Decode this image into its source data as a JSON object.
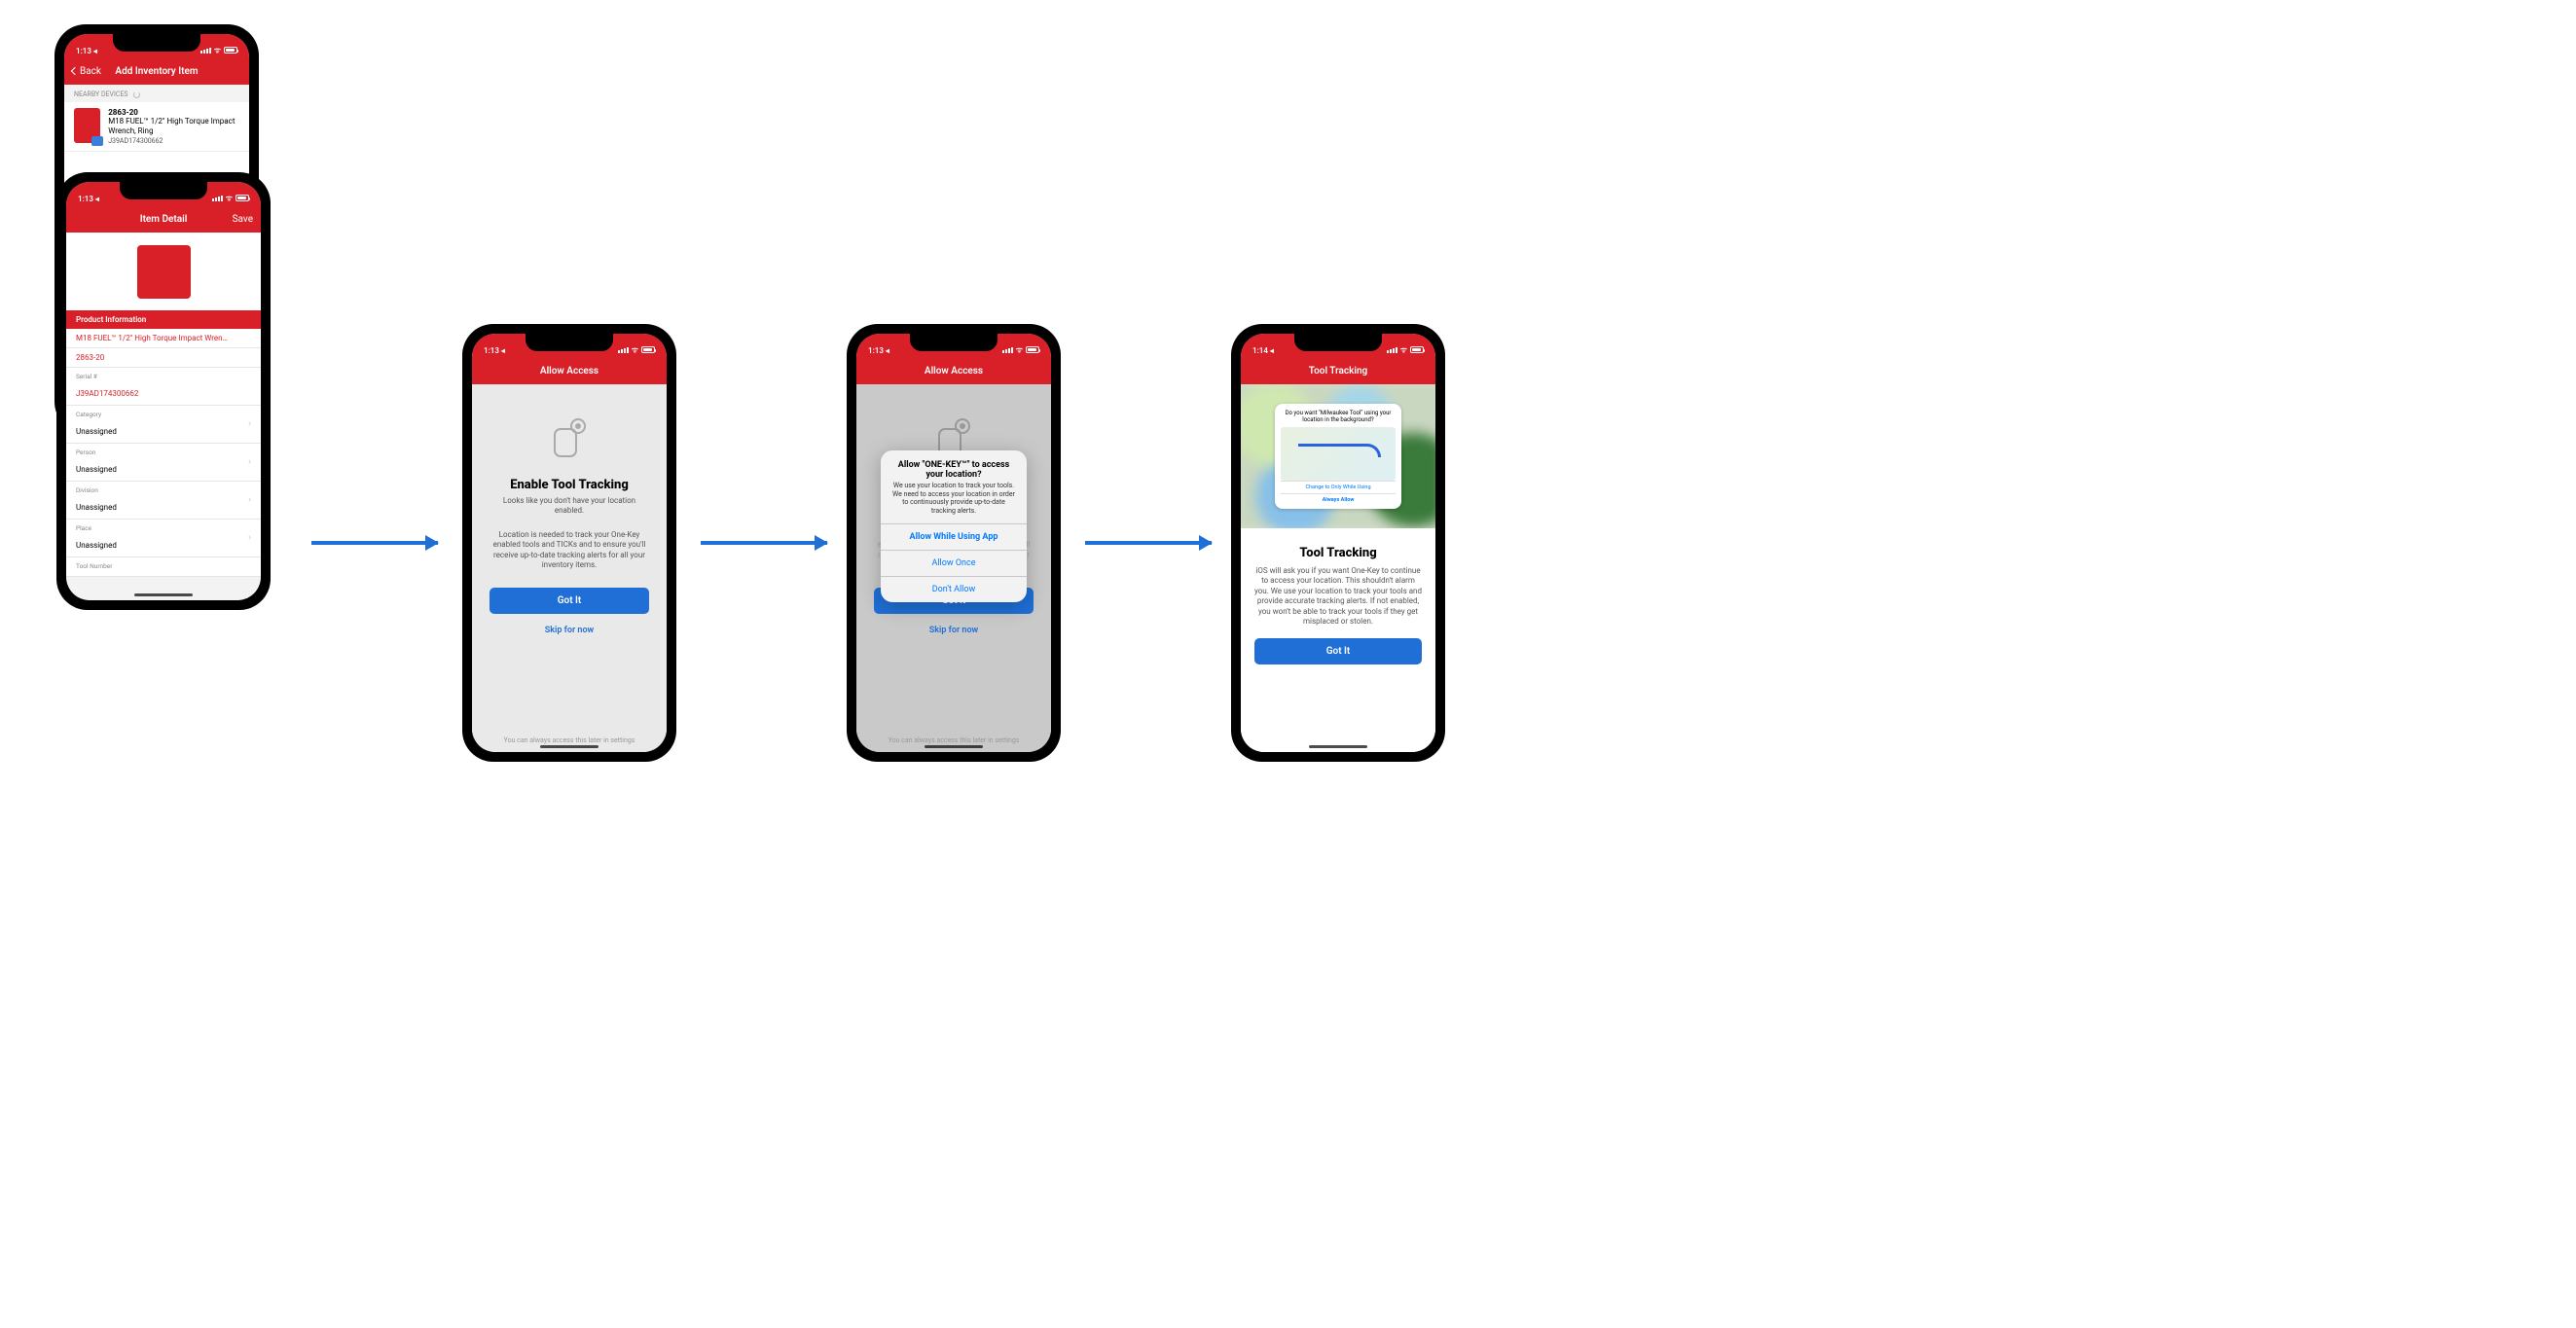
{
  "statusbar": {
    "time1": "1:13 ◂",
    "time2": "1:14 ◂",
    "wifi_glyph": "ᯤ"
  },
  "phone1": {
    "nav": {
      "back": "Back",
      "title": "Add Inventory Item"
    },
    "section": "NEARBY DEVICES",
    "device": {
      "model": "2863-20",
      "name": "M18 FUEL™ 1/2\" High Torque Impact Wrench, Ring",
      "serial": "J39AD174300662"
    }
  },
  "phone2": {
    "nav": {
      "title": "Item Detail",
      "save": "Save"
    },
    "section": "Product Information",
    "fields": {
      "name": "M18 FUEL™ 1/2\" High Torque Impact Wren…",
      "model": "2863-20",
      "serial_label": "Serial #",
      "serial": "J39AD174300662",
      "category_label": "Category",
      "category": "Unassigned",
      "person_label": "Person",
      "person": "Unassigned",
      "division_label": "Division",
      "division": "Unassigned",
      "place_label": "Place",
      "place": "Unassigned",
      "toolnum_label": "Tool Number"
    }
  },
  "phone3": {
    "nav_title": "Allow Access",
    "h1": "Enable Tool Tracking",
    "sub": "Looks like you don't have your location enabled.",
    "para": "Location is needed to track your One-Key enabled tools and TICKs and to ensure you'll receive up-to-date tracking alerts for all your inventory items.",
    "gotit": "Got It",
    "skip": "Skip for now",
    "footnote": "You can always access this later in settings"
  },
  "phone4": {
    "nav_title": "Allow Access",
    "alert": {
      "title": "Allow \"ONE-KEY™\" to access your location?",
      "msg": "We use your location to track your tools. We need to access your location in order to continuously provide up-to-date tracking alerts.",
      "opt1": "Allow While Using App",
      "opt2": "Allow Once",
      "opt3": "Don't Allow"
    },
    "gotit": "Got It",
    "skip": "Skip for now",
    "footnote": "You can always access this later in settings"
  },
  "phone5": {
    "nav_title": "Tool Tracking",
    "card": {
      "title": "Do you want \"Milwaukee Tool\" using your location in the background?",
      "opt1": "Change to Only While Using",
      "opt2": "Always Allow"
    },
    "h1": "Tool Tracking",
    "para": "iOS will ask you if you want One-Key to continue to access your location. This shouldn't alarm you. We use your location to track your tools and provide accurate tracking alerts. If not enabled, you won't be able to track your tools if they get misplaced or stolen.",
    "gotit": "Got It"
  }
}
